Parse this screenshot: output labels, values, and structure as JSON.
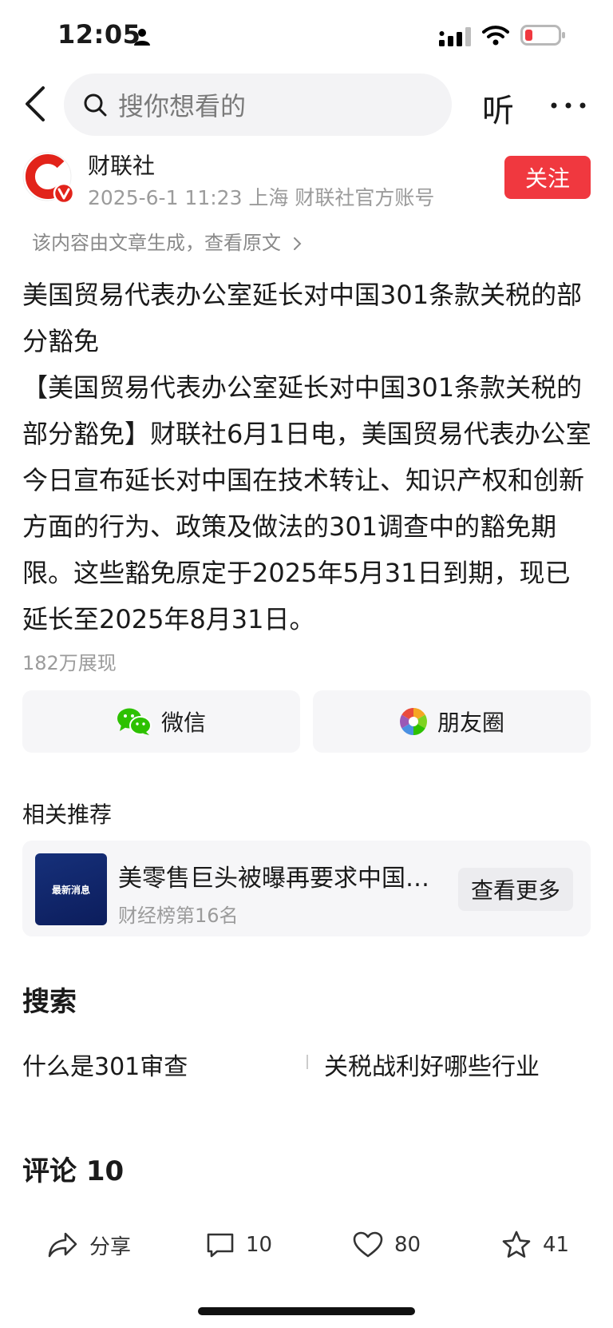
{
  "status_bar": {
    "time": "12:05"
  },
  "top_bar": {
    "search_placeholder": "搜你想看的",
    "listen_label": "听"
  },
  "author": {
    "name": "财联社",
    "meta": "2025-6-1 11:23  上海  财联社官方账号",
    "follow_label": "关注"
  },
  "source_note": "该内容由文章生成，查看原文",
  "article": {
    "title": "美国贸易代表办公室延长对中国301条款关税的部分豁免",
    "body": "【美国贸易代表办公室延长对中国301条款关税的部分豁免】财联社6月1日电，美国贸易代表办公室今日宣布延长对中国在技术转让、知识产权和创新方面的行为、政策及做法的301调查中的豁免期限。这些豁免原定于2025年5月31日到期，现已延长至2025年8月31日。",
    "views": "182万展现"
  },
  "share": {
    "wechat_label": "微信",
    "moments_label": "朋友圈"
  },
  "related": {
    "section_title": "相关推荐",
    "thumb_text": "最新消息",
    "title": "美零售巨头被曝再要求中国供应商降价",
    "subtitle": "财经榜第16名",
    "more_label": "查看更多"
  },
  "search_section": {
    "title": "搜索",
    "queries": [
      "什么是301审查",
      "关税战利好哪些行业"
    ]
  },
  "comments": {
    "title": "评论 10"
  },
  "bottom_bar": {
    "share_label": "分享",
    "comment_count": "10",
    "like_count": "80",
    "favorite_count": "41"
  },
  "colors": {
    "accent_red": "#f0383f",
    "wechat_green": "#2dc100"
  }
}
